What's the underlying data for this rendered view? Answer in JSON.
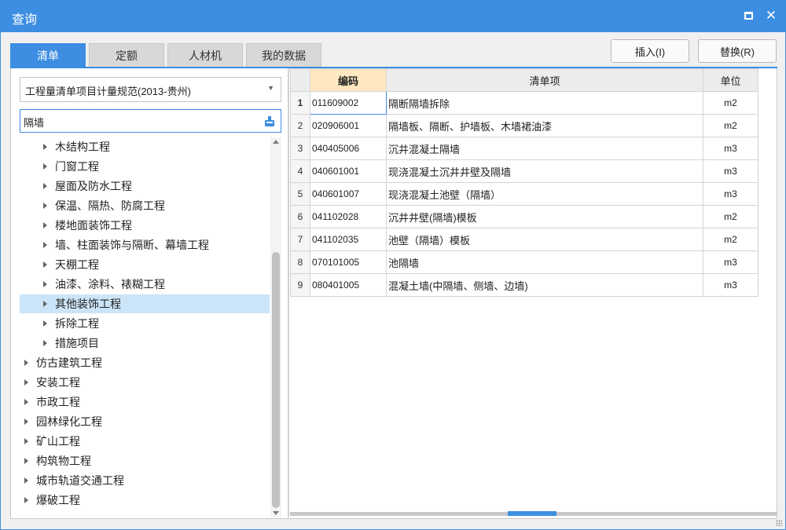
{
  "window": {
    "title": "查询",
    "maximize_icon": "maximize-icon",
    "close_symbol": "✕"
  },
  "tabs": [
    {
      "label": "清单",
      "active": true
    },
    {
      "label": "定额",
      "active": false
    },
    {
      "label": "人材机",
      "active": false
    },
    {
      "label": "我的数据",
      "active": false
    }
  ],
  "actions": {
    "insert_label": "插入(I)",
    "replace_label": "替换(R)"
  },
  "left": {
    "library_select": "工程量清单项目计量规范(2013-贵州)",
    "search_value": "隔墙",
    "tree": [
      {
        "label": "木结构工程",
        "level": 1,
        "selected": false
      },
      {
        "label": "门窗工程",
        "level": 1,
        "selected": false
      },
      {
        "label": "屋面及防水工程",
        "level": 1,
        "selected": false
      },
      {
        "label": "保温、隔热、防腐工程",
        "level": 1,
        "selected": false
      },
      {
        "label": "楼地面装饰工程",
        "level": 1,
        "selected": false
      },
      {
        "label": "墙、柱面装饰与隔断、幕墙工程",
        "level": 1,
        "selected": false
      },
      {
        "label": "天棚工程",
        "level": 1,
        "selected": false
      },
      {
        "label": "油漆、涂料、裱糊工程",
        "level": 1,
        "selected": false
      },
      {
        "label": "其他装饰工程",
        "level": 1,
        "selected": true
      },
      {
        "label": "拆除工程",
        "level": 1,
        "selected": false
      },
      {
        "label": "措施项目",
        "level": 1,
        "selected": false
      },
      {
        "label": "仿古建筑工程",
        "level": 0,
        "selected": false
      },
      {
        "label": "安装工程",
        "level": 0,
        "selected": false
      },
      {
        "label": "市政工程",
        "level": 0,
        "selected": false
      },
      {
        "label": "园林绿化工程",
        "level": 0,
        "selected": false
      },
      {
        "label": "矿山工程",
        "level": 0,
        "selected": false
      },
      {
        "label": "构筑物工程",
        "level": 0,
        "selected": false
      },
      {
        "label": "城市轨道交通工程",
        "level": 0,
        "selected": false
      },
      {
        "label": "爆破工程",
        "level": 0,
        "selected": false
      }
    ]
  },
  "table": {
    "headers": {
      "code": "编码",
      "name": "清单项",
      "unit": "单位"
    },
    "rows": [
      {
        "index": "1",
        "code": "011609002",
        "name": "隔断隔墙拆除",
        "unit": "m2"
      },
      {
        "index": "2",
        "code": "020906001",
        "name": "隔墙板、隔断、护墙板、木墙裙油漆",
        "unit": "m2"
      },
      {
        "index": "3",
        "code": "040405006",
        "name": "沉井混凝土隔墙",
        "unit": "m3"
      },
      {
        "index": "4",
        "code": "040601001",
        "name": "现浇混凝土沉井井壁及隔墙",
        "unit": "m3"
      },
      {
        "index": "5",
        "code": "040601007",
        "name": "现浇混凝土池壁（隔墙）",
        "unit": "m3"
      },
      {
        "index": "6",
        "code": "041102028",
        "name": "沉井井壁(隔墙)模板",
        "unit": "m2"
      },
      {
        "index": "7",
        "code": "041102035",
        "name": "池壁（隔墙）模板",
        "unit": "m2"
      },
      {
        "index": "8",
        "code": "070101005",
        "name": "池隔墙",
        "unit": "m3"
      },
      {
        "index": "9",
        "code": "080401005",
        "name": "混凝土墙(中隔墙、侧墙、边墙)",
        "unit": "m3"
      }
    ]
  },
  "colors": {
    "accent": "#3d8ee2",
    "header_highlight": "#fde8c2",
    "selected_row": "#cce4f7"
  }
}
